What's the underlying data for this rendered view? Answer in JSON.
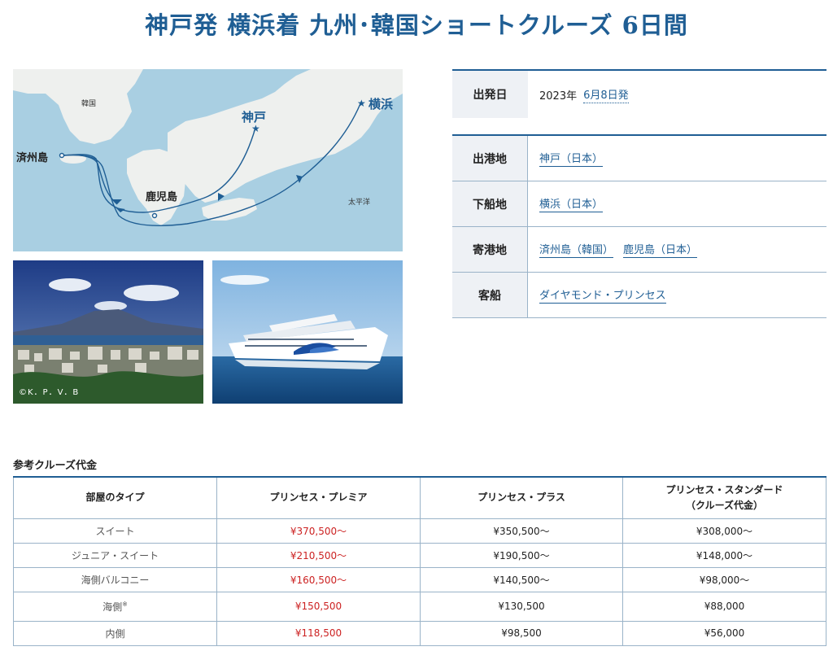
{
  "title": "神戸発 横浜着 九州･韓国ショートクルーズ 6日間",
  "map": {
    "labels": {
      "korea": "韓国",
      "jeju": "済州島",
      "kagoshima": "鹿児島",
      "kobe": "神戸",
      "yokohama": "横浜",
      "pacific": "太平洋"
    },
    "colors": {
      "sea": "#a9cfe2",
      "land": "#eef0ee",
      "route": "#1f5e94"
    }
  },
  "photos": {
    "kagoshima_credit": "©K．P．V．B"
  },
  "departure": {
    "label": "出発日",
    "year": "2023年",
    "date": "6月8日発"
  },
  "details": [
    {
      "label": "出港地",
      "links": [
        "神戸（日本）"
      ]
    },
    {
      "label": "下船地",
      "links": [
        "横浜（日本）"
      ]
    },
    {
      "label": "寄港地",
      "links": [
        "済州島（韓国）",
        "鹿児島（日本）"
      ]
    },
    {
      "label": "客船",
      "links": [
        "ダイヤモンド・プリンセス"
      ]
    }
  ],
  "prices": {
    "heading": "参考クルーズ代金",
    "headers": [
      "部屋のタイプ",
      "プリンセス・プレミア",
      "プリンセス・プラス",
      "プリンセス・スタンダード",
      "（クルーズ代金）"
    ],
    "rows": [
      {
        "name": "スイート",
        "note": "",
        "premier": "¥370,500～",
        "plus": "¥350,500～",
        "standard": "¥308,000～"
      },
      {
        "name": "ジュニア・スイート",
        "note": "",
        "premier": "¥210,500～",
        "plus": "¥190,500～",
        "standard": "¥148,000～"
      },
      {
        "name": "海側バルコニー",
        "note": "",
        "premier": "¥160,500～",
        "plus": "¥140,500～",
        "standard": "¥98,000～"
      },
      {
        "name": "海側",
        "note": "※",
        "premier": "¥150,500",
        "plus": "¥130,500",
        "standard": "¥88,000"
      },
      {
        "name": "内側",
        "note": "",
        "premier": "¥118,500",
        "plus": "¥98,500",
        "standard": "¥56,000"
      }
    ]
  },
  "accent_color": "#1f5e94",
  "price_highlight_color": "#cc2222"
}
